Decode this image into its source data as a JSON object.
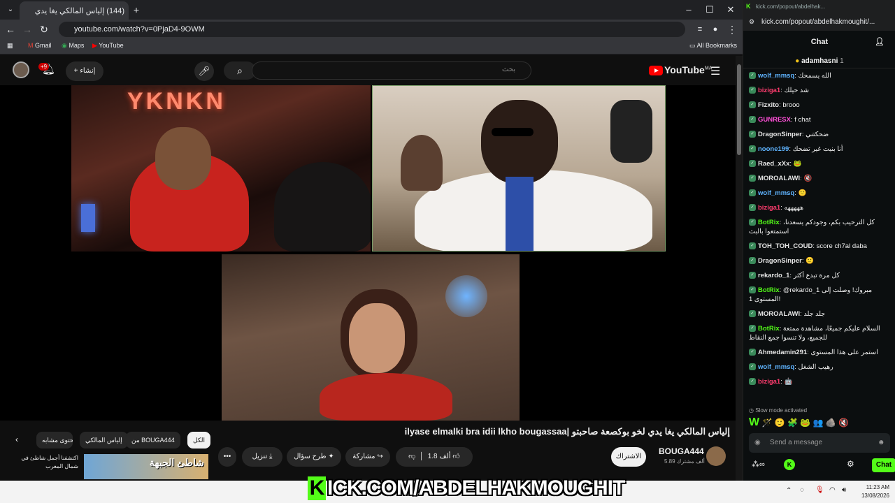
{
  "browser": {
    "tab_title": "(144) إلياس المالكي يغا يدي",
    "url": "youtube.com/watch?v=0PjaD4-9OWM",
    "bookmarks": [
      "Gmail",
      "Maps",
      "YouTube"
    ],
    "all_bookmarks": "All Bookmarks"
  },
  "youtube": {
    "notif_count": "+9",
    "create_label": "إنشاء",
    "search_placeholder": "بحث",
    "logo_text": "YouTube",
    "region": "MA",
    "video_title": "إلياس المالكي يغا يدي لخو بوكصعة صاحبتو |ilyase elmalki bra idii lkho bougassaa",
    "channel_name": "BOUGA444",
    "subscribers": "5.89 ألف مشترك",
    "subscribe_label": "الاشتراك",
    "likes": "1.8 ألف",
    "share_label": "مشاركة",
    "ask_label": "طرح سؤال",
    "download_label": "تنزيل",
    "chips": [
      "الكل",
      "من BOUGA444",
      "إلياس المالكي",
      "محتوى مشابه"
    ],
    "suggested_title": "اكتشفنا أجمل شاطئ في شمال المغرب",
    "suggested_thumb_text": "شاطئ الجبهة",
    "neon_sign": "YKNKN"
  },
  "kick": {
    "window_url": "kick.com/popout/abdelhak...",
    "url": "kick.com/popout/abdelhakmoughit/...",
    "header": "Chat",
    "pinned_user": "adamhasni",
    "pinned_count": "1",
    "messages": [
      {
        "user": "wolf_mmsq",
        "color": "#5fb4ff",
        "text": "الله يسمحك"
      },
      {
        "user": "biziga1",
        "color": "#ff3c6e",
        "text": "شد حيلك"
      },
      {
        "user": "Fizxito",
        "color": "#e6e6e6",
        "text": "brooo"
      },
      {
        "user": "GUNRESX",
        "color": "#ff4fd8",
        "text": "f chat"
      },
      {
        "user": "DragonSinper",
        "color": "#e6e6e6",
        "text": "ضحكتني"
      },
      {
        "user": "noone199",
        "color": "#5fb4ff",
        "text": "أنا بنيت غير تضحك"
      },
      {
        "user": "Raed_xXx",
        "color": "#e6e6e6",
        "text": "🐸"
      },
      {
        "user": "MOROALAWI",
        "color": "#e6e6e6",
        "text": "🔇"
      },
      {
        "user": "wolf_mmsq",
        "color": "#5fb4ff",
        "text": "🙂"
      },
      {
        "user": "biziga1",
        "color": "#ff3c6e",
        "text": "هههههه"
      },
      {
        "user": "BotRix",
        "color": "#53fc18",
        "text": "كل الترحيب بكم، وجودكم يسعدنا، استمتعوا بالبث"
      },
      {
        "user": "TOH_TOH_COUD",
        "color": "#e6e6e6",
        "text": "score ch7al daba"
      },
      {
        "user": "DragonSinper",
        "color": "#e6e6e6",
        "text": "🙂"
      },
      {
        "user": "rekardo_1",
        "color": "#e6e6e6",
        "text": "كل مرة تبدع أكثر"
      },
      {
        "user": "BotRix",
        "color": "#53fc18",
        "text": "@rekardo_1 مبروك! وصلت إلى المستوى 1!"
      },
      {
        "user": "MOROALAWI",
        "color": "#e6e6e6",
        "text": "جلد جلد"
      },
      {
        "user": "BotRix",
        "color": "#53fc18",
        "text": "السلام عليكم جميعًا، مشاهدة ممتعة للجميع، ولا تنسوا جمع النقاط"
      },
      {
        "user": "Ahmedamin291",
        "color": "#e6e6e6",
        "text": "استمر على هذا المستوى"
      },
      {
        "user": "wolf_mmsq",
        "color": "#5fb4ff",
        "text": "رهيب الشغل"
      },
      {
        "user": "biziga1",
        "color": "#ff3c6e",
        "text": "🤖"
      }
    ],
    "slow_mode": "Slow mode activated",
    "send_placeholder": "Send a message",
    "chat_button": "Chat"
  },
  "overlay": {
    "watermark": "ICK.COM/ABDELHAKMOUGHIT",
    "watermark_k": "K"
  },
  "taskbar": {
    "time": "11:23 AM",
    "date": "13/08/2026"
  }
}
